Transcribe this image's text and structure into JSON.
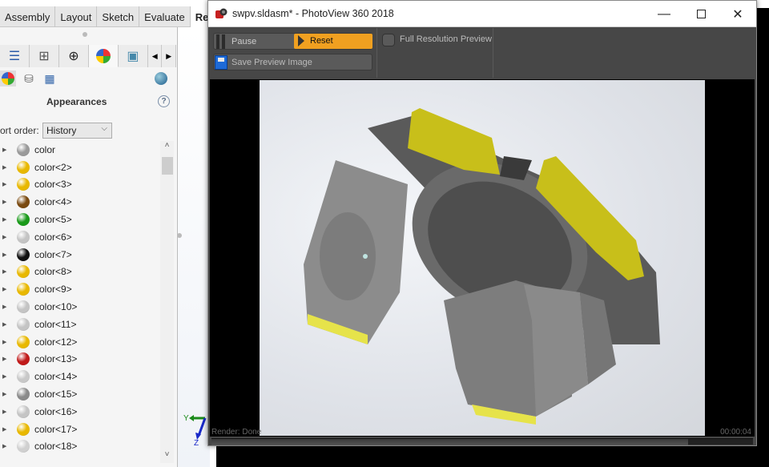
{
  "ribbon": {
    "tabs": [
      {
        "label": "Assembly"
      },
      {
        "label": "Layout"
      },
      {
        "label": "Sketch"
      },
      {
        "label": "Evaluate"
      },
      {
        "label": "Ren"
      }
    ]
  },
  "task_pane": {
    "title": "Appearances",
    "help_label": "?",
    "sort_label": "ort order:",
    "sort_value": "History",
    "items": [
      {
        "label": "color",
        "color": "#9a9a9a"
      },
      {
        "label": "color<2>",
        "color": "#e8b800"
      },
      {
        "label": "color<3>",
        "color": "#e8b800"
      },
      {
        "label": "color<4>",
        "color": "#7a4a10"
      },
      {
        "label": "color<5>",
        "color": "#1a9a1a"
      },
      {
        "label": "color<6>",
        "color": "#c4c4c4"
      },
      {
        "label": "color<7>",
        "color": "#111111"
      },
      {
        "label": "color<8>",
        "color": "#e8b800"
      },
      {
        "label": "color<9>",
        "color": "#e8b800"
      },
      {
        "label": "color<10>",
        "color": "#c4c4c4"
      },
      {
        "label": "color<11>",
        "color": "#c4c4c4"
      },
      {
        "label": "color<12>",
        "color": "#e8b800"
      },
      {
        "label": "color<13>",
        "color": "#c01a1a"
      },
      {
        "label": "color<14>",
        "color": "#c8c8c8"
      },
      {
        "label": "color<15>",
        "color": "#8a8a8a"
      },
      {
        "label": "color<16>",
        "color": "#c4c4c4"
      },
      {
        "label": "color<17>",
        "color": "#e8b800"
      },
      {
        "label": "color<18>",
        "color": "#d0d0d0"
      }
    ]
  },
  "triad": {
    "y_label": "Y",
    "z_label": "Z"
  },
  "photoview": {
    "title": "swpv.sldasm* - PhotoView 360 2018",
    "pause_label": "Pause",
    "reset_label": "Reset",
    "save_label": "Save Preview Image",
    "full_res_label": "Full Resolution Preview",
    "full_res_checked": false,
    "status": "Render: Done",
    "elapsed": "00:00:04",
    "progress": 0.88,
    "accent": "#f0a020"
  }
}
